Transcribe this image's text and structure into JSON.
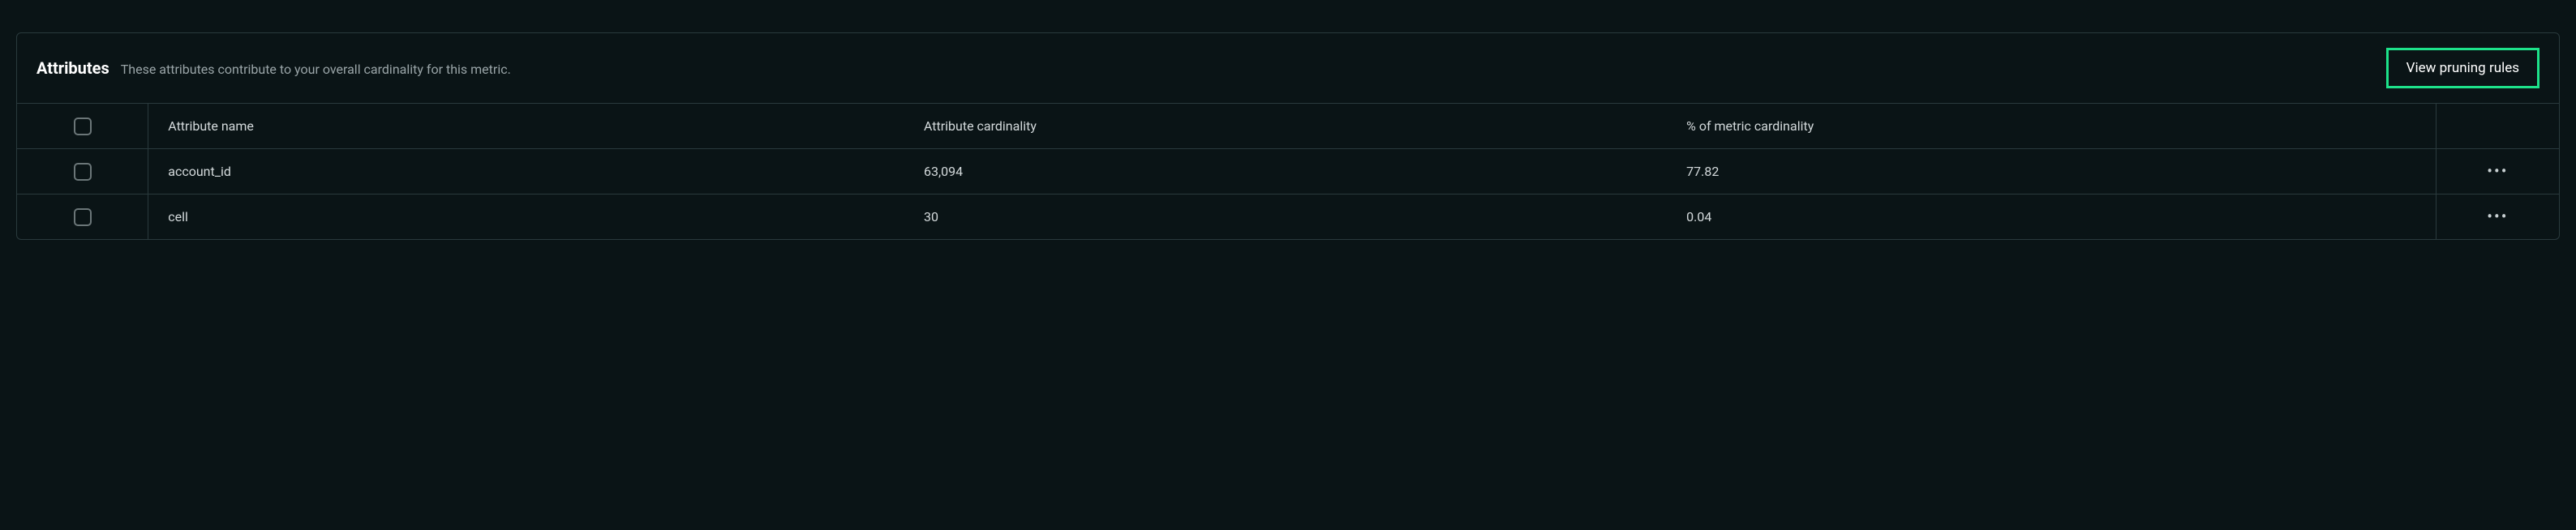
{
  "header": {
    "title": "Attributes",
    "subtitle": "These attributes contribute to your overall cardinality for this metric.",
    "pruning_button": "View pruning rules"
  },
  "table": {
    "columns": {
      "name": "Attribute name",
      "cardinality": "Attribute cardinality",
      "percent": "% of metric cardinality"
    },
    "rows": [
      {
        "name": "account_id",
        "cardinality": "63,094",
        "percent": "77.82"
      },
      {
        "name": "cell",
        "cardinality": "30",
        "percent": "0.04"
      }
    ]
  },
  "icons": {
    "ellipsis": "•••"
  },
  "colors": {
    "accent_green": "#1de28a",
    "background": "#0a1416",
    "border": "#2a3a3d"
  }
}
